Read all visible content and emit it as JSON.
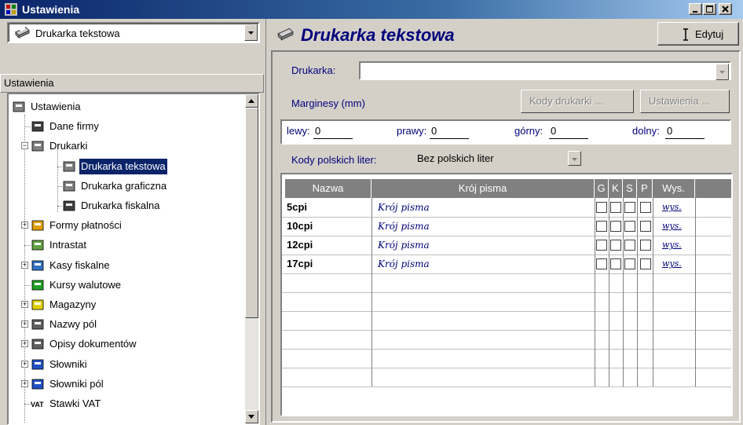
{
  "window": {
    "title": "Ustawienia",
    "colors": {
      "titlebar_start": "#0a246a",
      "titlebar_end": "#a6caf0",
      "accent_text": "#00007c",
      "selection": "#0a246a"
    }
  },
  "left": {
    "combo_value": "Drukarka tekstowa",
    "section_header": "Ustawienia",
    "tree": [
      {
        "label": "Ustawienia",
        "icon": "root-settings-icon"
      },
      {
        "label": "Dane firmy",
        "icon": "company-data-icon"
      },
      {
        "label": "Drukarki",
        "icon": "printers-icon",
        "expander": "−"
      },
      {
        "label": "Drukarka tekstowa",
        "icon": "text-printer-icon",
        "selected": true
      },
      {
        "label": "Drukarka graficzna",
        "icon": "graphic-printer-icon"
      },
      {
        "label": "Drukarka fiskalna",
        "icon": "fiscal-printer-icon"
      },
      {
        "label": "Formy płatności",
        "icon": "payment-forms-icon",
        "expander": "+"
      },
      {
        "label": "Intrastat",
        "icon": "intrastat-icon"
      },
      {
        "label": "Kasy fiskalne",
        "icon": "cash-registers-icon",
        "expander": "+"
      },
      {
        "label": "Kursy walutowe",
        "icon": "exchange-rates-icon"
      },
      {
        "label": "Magazyny",
        "icon": "warehouses-icon",
        "expander": "+"
      },
      {
        "label": "Nazwy pól",
        "icon": "field-names-icon",
        "expander": "+"
      },
      {
        "label": "Opisy dokumentów",
        "icon": "document-descriptions-icon",
        "expander": "+"
      },
      {
        "label": "Słowniki",
        "icon": "dictionaries-icon",
        "expander": "+"
      },
      {
        "label": "Słowniki pól",
        "icon": "field-dictionaries-icon",
        "expander": "+"
      },
      {
        "label": "Stawki VAT",
        "icon": "vat-rates-icon",
        "icon_text": "VAT"
      }
    ]
  },
  "right": {
    "title": "Drukarka tekstowa",
    "edit_label": "Edytuj",
    "printer_label": "Drukarka:",
    "printer_value": "",
    "margins_label": "Marginesy (mm)",
    "btn_codes": "Kody drukarki ...",
    "btn_settings": "Ustawienia ...",
    "margins": {
      "left_label": "lewy:",
      "left_value": "0",
      "right_label": "prawy:",
      "right_value": "0",
      "top_label": "górny:",
      "top_value": "0",
      "bottom_label": "dolny:",
      "bottom_value": "0"
    },
    "polish_codes_label": "Kody polskich liter:",
    "polish_codes_value": "Bez polskich liter",
    "grid": {
      "headers": [
        "Nazwa",
        "Krój pisma",
        "G",
        "K",
        "S",
        "P",
        "Wys."
      ],
      "rows": [
        {
          "name": "5cpi",
          "font": "Krój pisma",
          "wys": "wys."
        },
        {
          "name": "10cpi",
          "font": "Krój pisma",
          "wys": "wys."
        },
        {
          "name": "12cpi",
          "font": "Krój pisma",
          "wys": "wys."
        },
        {
          "name": "17cpi",
          "font": "Krój pisma",
          "wys": "wys."
        }
      ]
    }
  }
}
